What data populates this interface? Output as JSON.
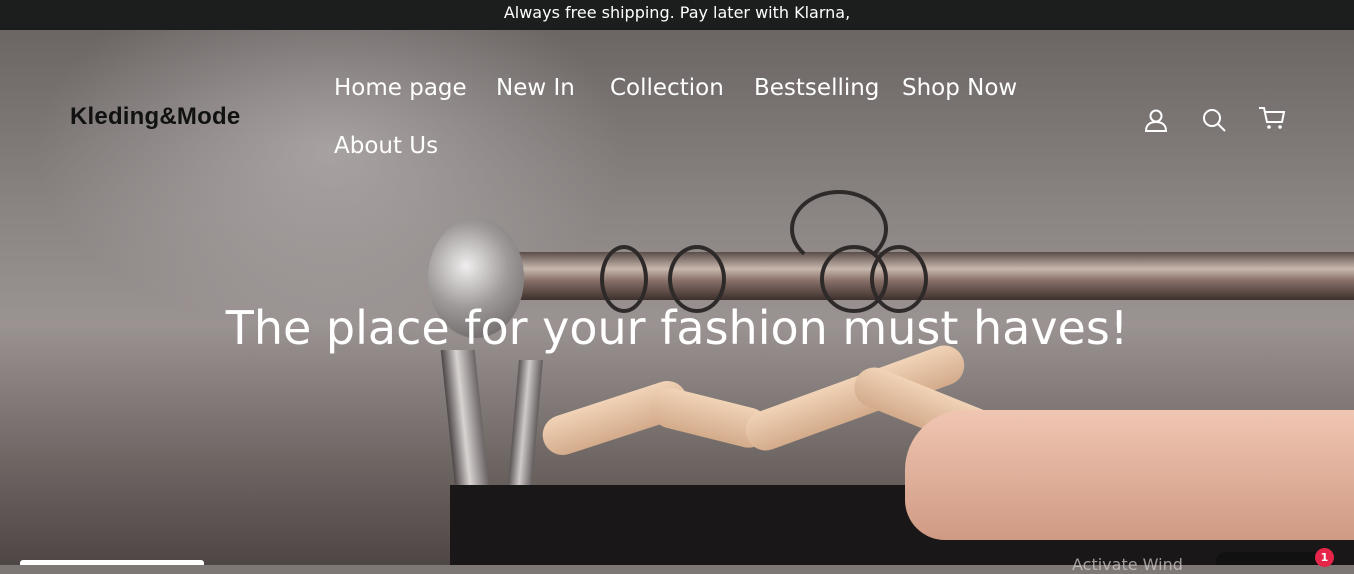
{
  "announcement": {
    "text": "Always free shipping. Pay later with Klarna,"
  },
  "header": {
    "logo": "Kleding&Mode",
    "nav": [
      {
        "label": "Home page"
      },
      {
        "label": "New In"
      },
      {
        "label": "Collection"
      },
      {
        "label": "Bestselling"
      },
      {
        "label": "Shop Now"
      },
      {
        "label": "About Us"
      }
    ],
    "icons": [
      "user-icon",
      "search-icon",
      "cart-icon"
    ]
  },
  "hero": {
    "title": "The place for your fashion must haves!"
  },
  "widgets": {
    "watermark": "Activate Wind",
    "chat_badge_count": "1"
  },
  "colors": {
    "announcement_bg": "#1c1d1d",
    "badge": "#e5254a",
    "nav_text": "#ffffff"
  }
}
